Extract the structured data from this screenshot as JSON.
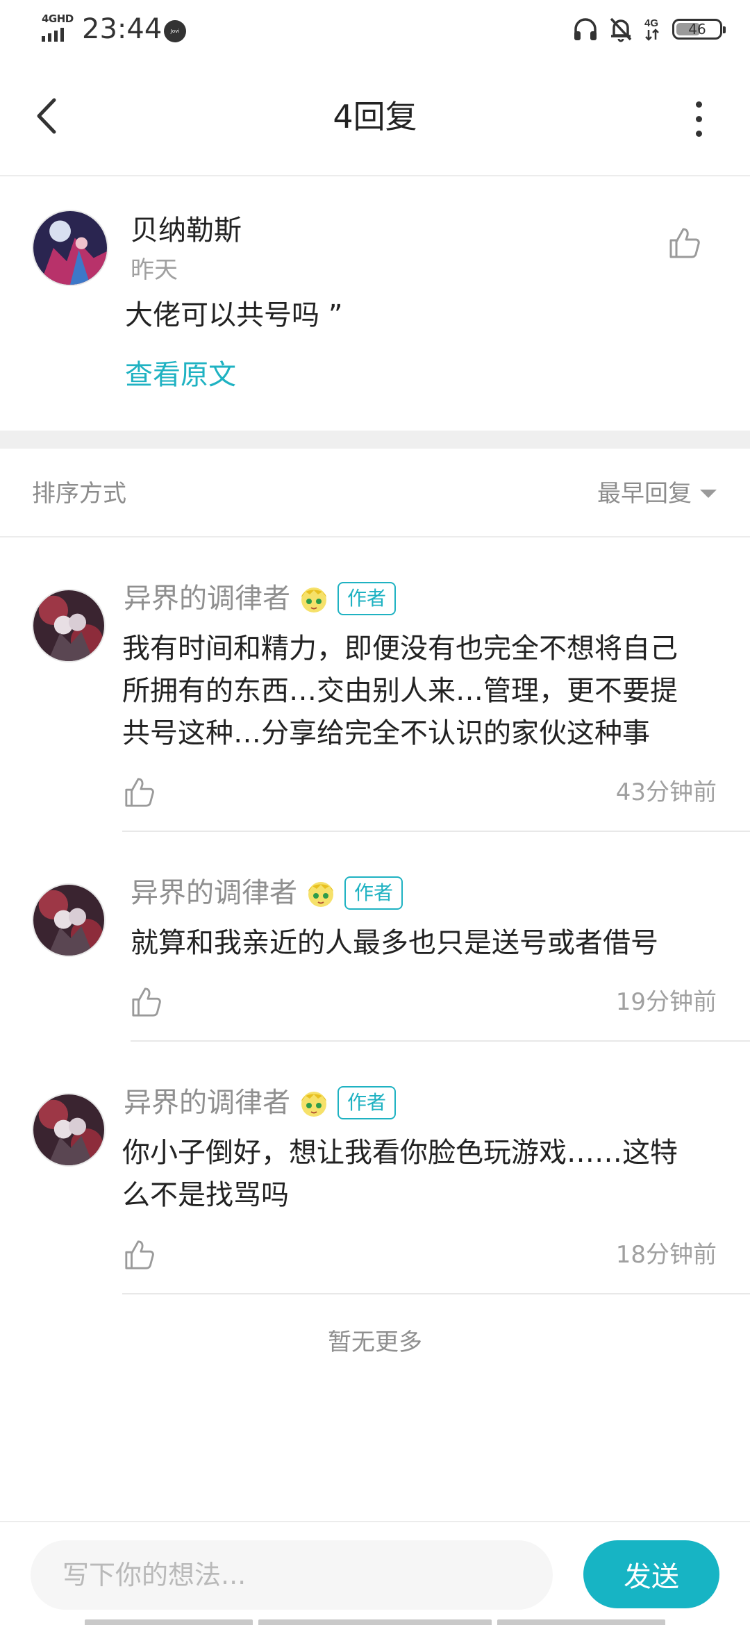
{
  "status_bar": {
    "network": "4GHD",
    "time": "23:44",
    "jovi": "Jovi",
    "net_right": "4G",
    "battery": "46"
  },
  "header": {
    "title": "4回复"
  },
  "original": {
    "author": "贝纳勒斯",
    "time": "昨天",
    "text": "大佬可以共号吗 ”",
    "view_original": "查看原文"
  },
  "sort": {
    "label": "排序方式",
    "selected": "最早回复"
  },
  "replies": [
    {
      "author": "异界的调律者",
      "badge": "作者",
      "lines": [
        "我有时间和精力，即便没有也完全不想将自己",
        "所拥有的东西…交由别人来…管理，更不要提",
        "共号这种…分享给完全不认识的家伙这种事"
      ],
      "time": "43分钟前"
    },
    {
      "author": "异界的调律者",
      "badge": "作者",
      "lines": [
        "就算和我亲近的人最多也只是送号或者借号"
      ],
      "time": "19分钟前"
    },
    {
      "author": "异界的调律者",
      "badge": "作者",
      "lines": [
        "你小子倒好，想让我看你脸色玩游戏……这特",
        "么不是找骂吗"
      ],
      "time": "18分钟前"
    }
  ],
  "footer": {
    "no_more": "暂无更多"
  },
  "composer": {
    "placeholder": "写下你的想法...",
    "send": "发送"
  },
  "colors": {
    "accent": "#1fb2c2",
    "send_button": "#17b4c4",
    "muted_text": "#8f8f8f"
  }
}
